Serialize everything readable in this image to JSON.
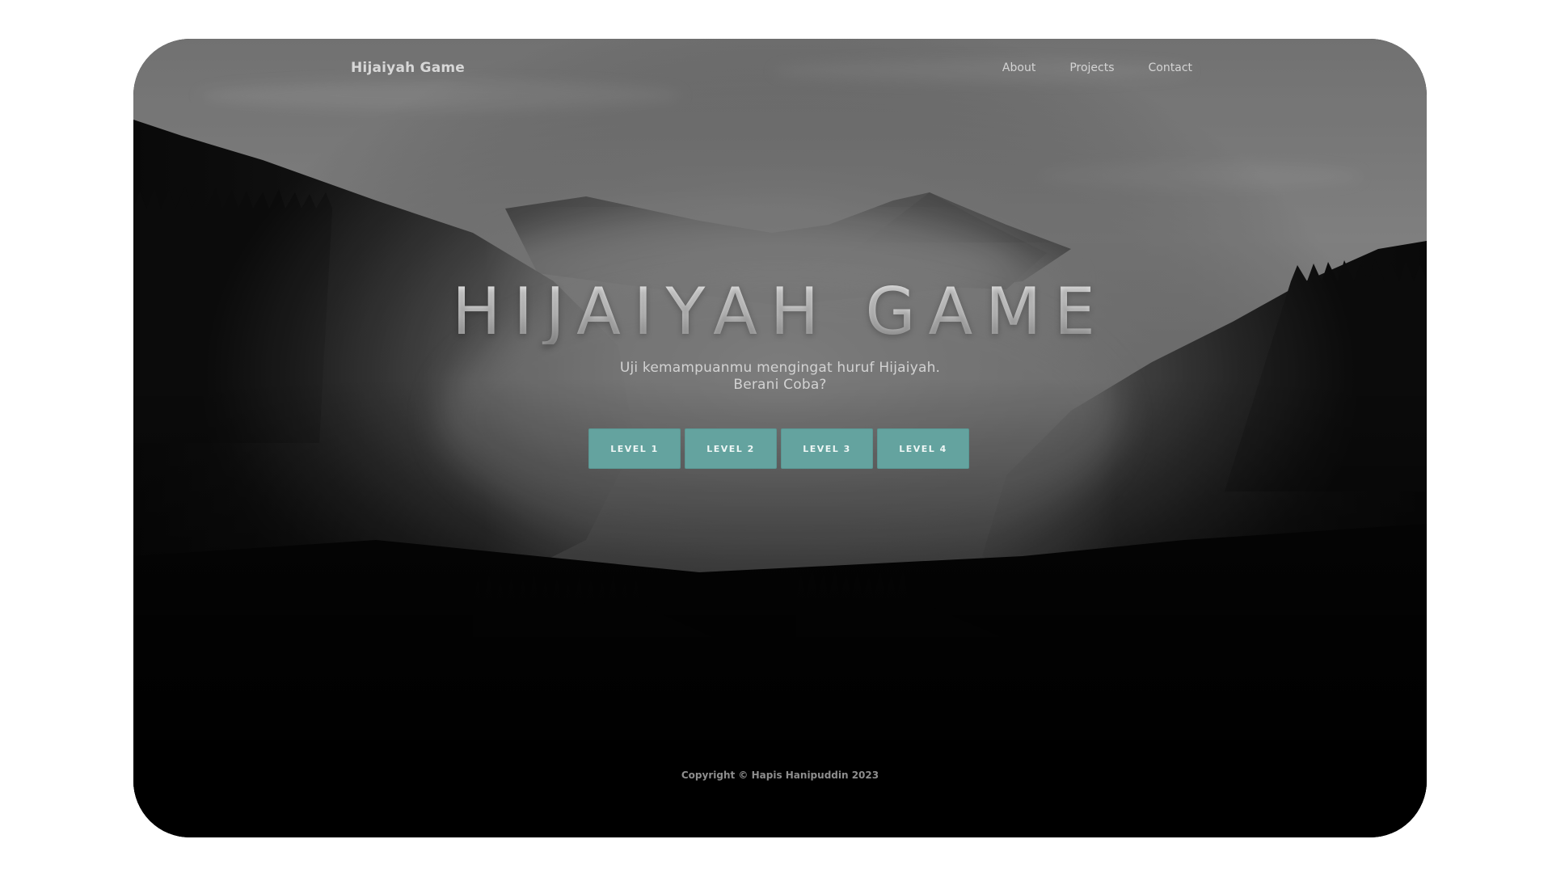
{
  "navbar": {
    "brand": "Hijaiyah Game",
    "links": [
      {
        "label": "About"
      },
      {
        "label": "Projects"
      },
      {
        "label": "Contact"
      }
    ]
  },
  "hero": {
    "title": "HIJAIYAH GAME",
    "subtitle_line1": "Uji kemampuanmu mengingat huruf Hijaiyah.",
    "subtitle_line2": "Berani Coba?",
    "levels": [
      {
        "label": "LEVEL 1"
      },
      {
        "label": "LEVEL 2"
      },
      {
        "label": "LEVEL 3"
      },
      {
        "label": "LEVEL 4"
      }
    ]
  },
  "footer": {
    "copyright": "Copyright © Hapis Hanipuddin 2023"
  },
  "colors": {
    "accent": "#64a39f",
    "page_background": "#ffffff",
    "scene_dark": "#050505"
  }
}
